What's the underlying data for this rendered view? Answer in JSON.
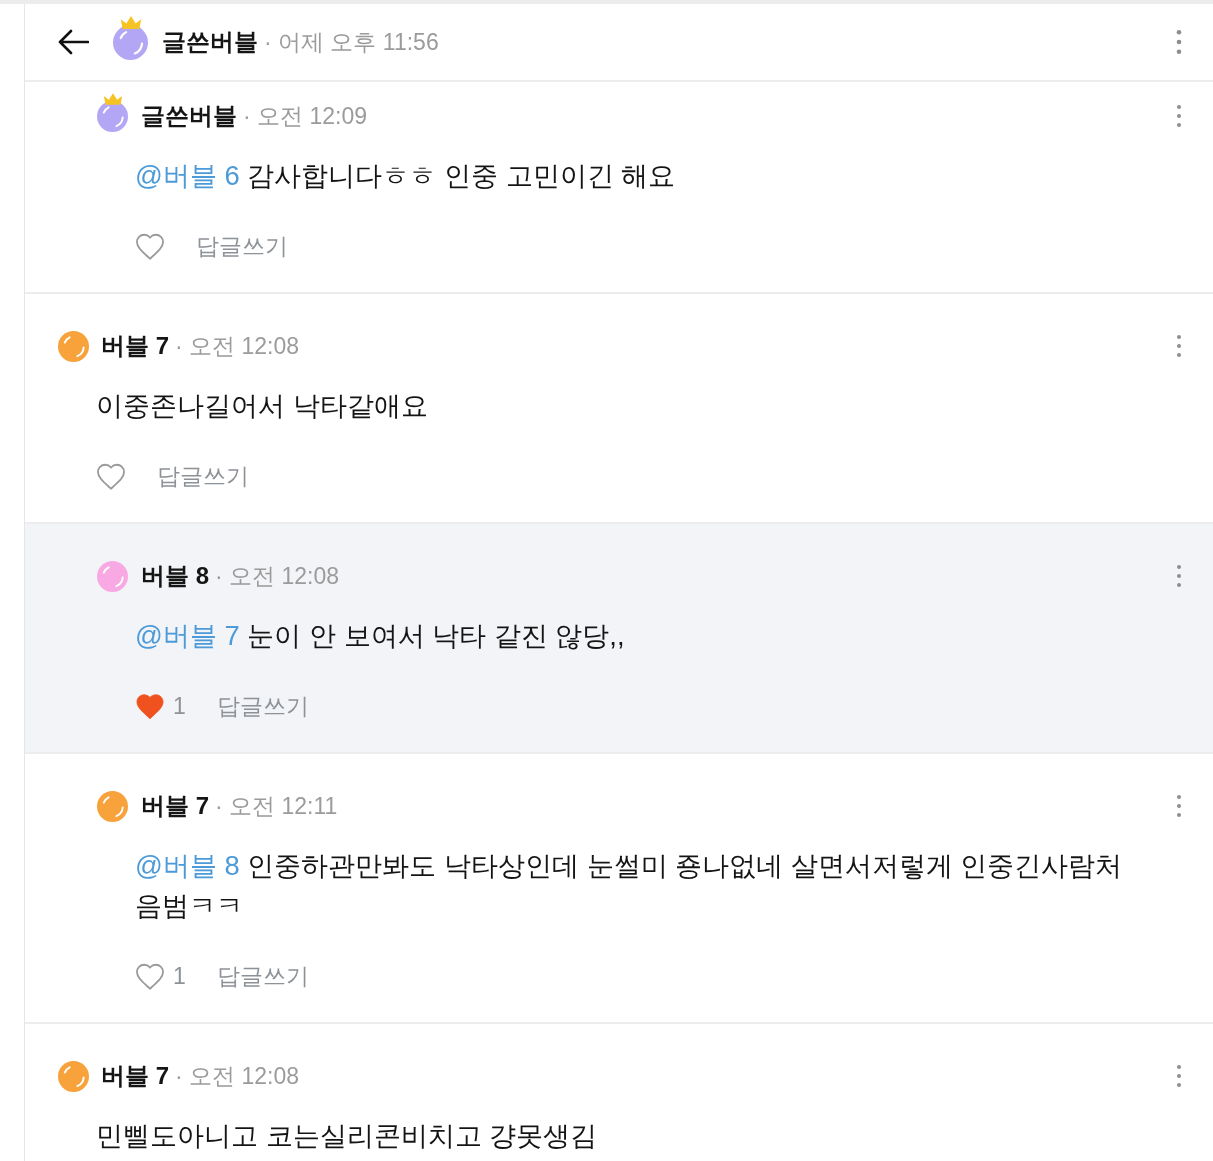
{
  "header": {
    "author": "글쓴버블",
    "time": "· 어제 오후 11:56"
  },
  "earlier_replies": [
    {
      "author": "글쓴버블",
      "is_post_author": true,
      "color": "#b3a6f4",
      "time": "· 오전 12:09",
      "mention": "@버블 6",
      "text": "감사합니다ㅎㅎ 인중 고민이긴 해요",
      "highlighted": false,
      "liked": false,
      "reply_label": "답글쓰기"
    }
  ],
  "comments": [
    {
      "author": "버블 7",
      "is_post_author": false,
      "color": "#f7a23a",
      "time": "· 오전 12:08",
      "text": "이중존나길어서 낙타같애요",
      "highlighted": false,
      "liked": false,
      "reply_label": "답글쓰기",
      "replies": [
        {
          "author": "버블 8",
          "is_post_author": false,
          "color": "#f8a8e2",
          "time": "· 오전 12:08",
          "mention": "@버블 7",
          "text": "눈이 안 보여서 낙타 같진 않당,,",
          "highlighted": true,
          "liked": true,
          "like_count": "1",
          "reply_label": "답글쓰기"
        },
        {
          "author": "버블 7",
          "is_post_author": false,
          "color": "#f7a23a",
          "time": "· 오전 12:11",
          "mention": "@버블 8",
          "text": "인중하관만봐도 낙타상인데 눈썰미 죵나없네 살면서저렇게 인중긴사람처음범ㅋㅋ",
          "highlighted": false,
          "liked": false,
          "like_count": "1",
          "reply_label": "답글쓰기"
        }
      ]
    },
    {
      "author": "버블 7",
      "is_post_author": false,
      "color": "#f7a23a",
      "time": "· 오전 12:08",
      "text": "민삘도아니고 코는실리콘비치고 걍못생김",
      "highlighted": false
    }
  ]
}
